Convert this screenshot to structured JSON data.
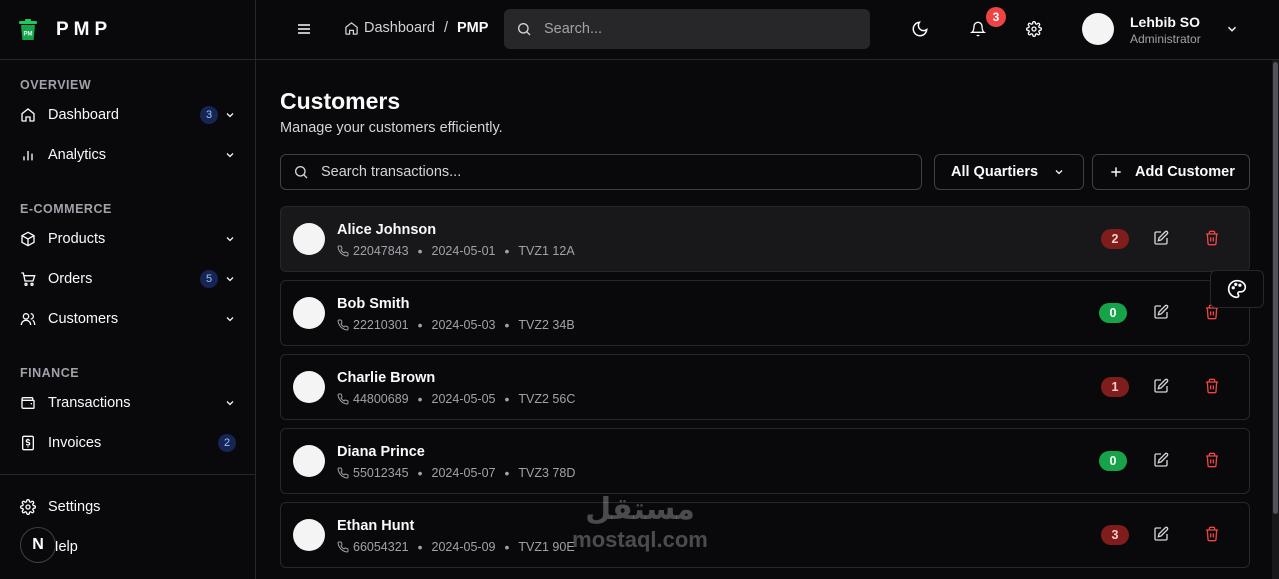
{
  "brand": {
    "name": "PMP"
  },
  "sidebar": {
    "sections": [
      {
        "heading": "OVERVIEW",
        "items": [
          {
            "label": "Dashboard",
            "badge": "3"
          },
          {
            "label": "Analytics"
          }
        ]
      },
      {
        "heading": "E-COMMERCE",
        "items": [
          {
            "label": "Products"
          },
          {
            "label": "Orders",
            "badge": "5"
          },
          {
            "label": "Customers"
          }
        ]
      },
      {
        "heading": "FINANCE",
        "items": [
          {
            "label": "Transactions"
          },
          {
            "label": "Invoices",
            "badge": "2"
          }
        ]
      }
    ],
    "bottom": {
      "settings": "Settings",
      "help": "Help"
    },
    "n_logo": "N"
  },
  "header": {
    "breadcrumb": {
      "home": "Dashboard",
      "separator": "/",
      "current": "PMP"
    },
    "search_placeholder": "Search...",
    "notification_count": "3",
    "user": {
      "name": "Lehbib SO",
      "role": "Administrator"
    }
  },
  "main": {
    "title": "Customers",
    "subtitle": "Manage your customers efficiently.",
    "search_placeholder": "Search transactions...",
    "filter": {
      "selected": "All Quartiers"
    },
    "add_button": "Add Customer",
    "customers": [
      {
        "name": "Alice Johnson",
        "phone": "22047843",
        "date": "2024-05-01",
        "code": "TVZ1 12A",
        "count": "2",
        "status": "red"
      },
      {
        "name": "Bob Smith",
        "phone": "22210301",
        "date": "2024-05-03",
        "code": "TVZ2 34B",
        "count": "0",
        "status": "green"
      },
      {
        "name": "Charlie Brown",
        "phone": "44800689",
        "date": "2024-05-05",
        "code": "TVZ2 56C",
        "count": "1",
        "status": "red"
      },
      {
        "name": "Diana Prince",
        "phone": "55012345",
        "date": "2024-05-07",
        "code": "TVZ3 78D",
        "count": "0",
        "status": "green"
      },
      {
        "name": "Ethan Hunt",
        "phone": "66054321",
        "date": "2024-05-09",
        "code": "TVZ1 90E",
        "count": "3",
        "status": "red"
      }
    ]
  },
  "watermark": {
    "arabic": "مستقل",
    "latin": "mostaql.com"
  },
  "colors": {
    "danger": "#ef4444",
    "success": "#16a34a",
    "badge_blue_bg": "#172554",
    "badge_blue_fg": "#93c5fd"
  }
}
